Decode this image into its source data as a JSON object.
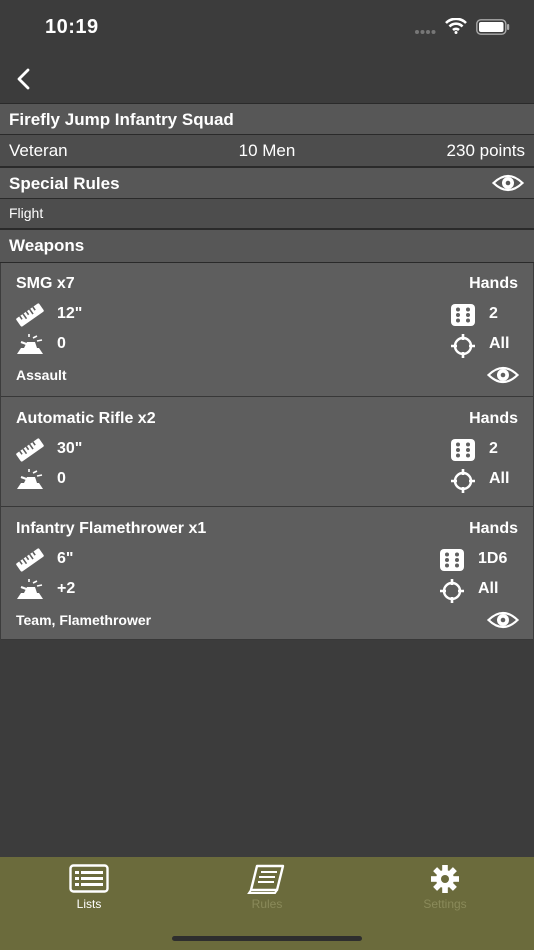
{
  "status": {
    "time": "10:19"
  },
  "unit": {
    "name": "Firefly Jump Infantry Squad",
    "experience": "Veteran",
    "size": "10 Men",
    "points": "230 points"
  },
  "sections": {
    "special_rules_title": "Special Rules",
    "weapons_title": "Weapons"
  },
  "special_rules": "Flight",
  "weapons": [
    {
      "name": "SMG x7",
      "type": "Hands",
      "range": "12\"",
      "shots": "2",
      "pen": "0",
      "arc": "All",
      "rules": "Assault"
    },
    {
      "name": "Automatic Rifle x2",
      "type": "Hands",
      "range": "30\"",
      "shots": "2",
      "pen": "0",
      "arc": "All",
      "rules": ""
    },
    {
      "name": "Infantry Flamethrower x1",
      "type": "Hands",
      "range": "6\"",
      "shots": "1D6",
      "pen": "+2",
      "arc": "All",
      "rules": "Team, Flamethrower"
    }
  ],
  "tabs": [
    {
      "label": "Lists",
      "icon": "list-icon",
      "active": true
    },
    {
      "label": "Rules",
      "icon": "book-icon",
      "active": false
    },
    {
      "label": "Settings",
      "icon": "gear-icon",
      "active": false
    }
  ],
  "colors": {
    "background": "#3c3c3c",
    "header": "#575757",
    "card": "#5e5e5e",
    "tab_bar": "#6b6b3c",
    "inactive_tab": "#8a8a5a"
  }
}
